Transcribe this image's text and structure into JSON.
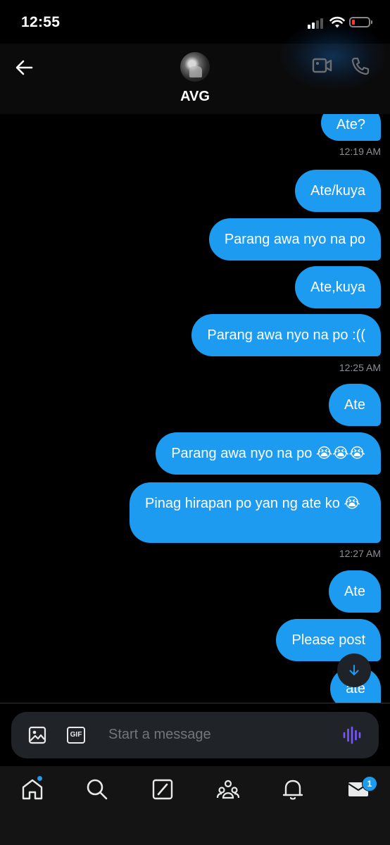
{
  "status_bar": {
    "time": "12:55"
  },
  "header": {
    "contact_name": "AVG"
  },
  "messages": [
    {
      "text": "Ate?"
    },
    {
      "text": "Ate/kuya"
    },
    {
      "text": "Parang awa nyo na po"
    },
    {
      "text": "Ate,kuya"
    },
    {
      "text": "Parang awa nyo na po :(("
    },
    {
      "text": "Ate"
    },
    {
      "text": "Parang awa nyo na po 😭😭😭"
    },
    {
      "text": "Pinag hirapan po yan ng ate ko 😭"
    },
    {
      "text": "Ate"
    },
    {
      "text": "Please post"
    },
    {
      "text": "ate"
    }
  ],
  "timestamps": [
    "12:19 AM",
    "12:25 AM",
    "12:27 AM"
  ],
  "composer": {
    "placeholder": "Start a message",
    "gif_label": "GIF"
  },
  "nav": {
    "messages_badge": "1"
  },
  "colors": {
    "accent": "#1d9bf0",
    "background": "#000000",
    "composer": "#202327",
    "voice": "#7856ff"
  },
  "icons": [
    "back-arrow-icon",
    "video-call-icon",
    "phone-call-icon",
    "image-icon",
    "gif-icon",
    "voice-icon",
    "scroll-down-icon",
    "home-icon",
    "search-icon",
    "grok-icon",
    "communities-icon",
    "notifications-icon",
    "messages-icon"
  ]
}
